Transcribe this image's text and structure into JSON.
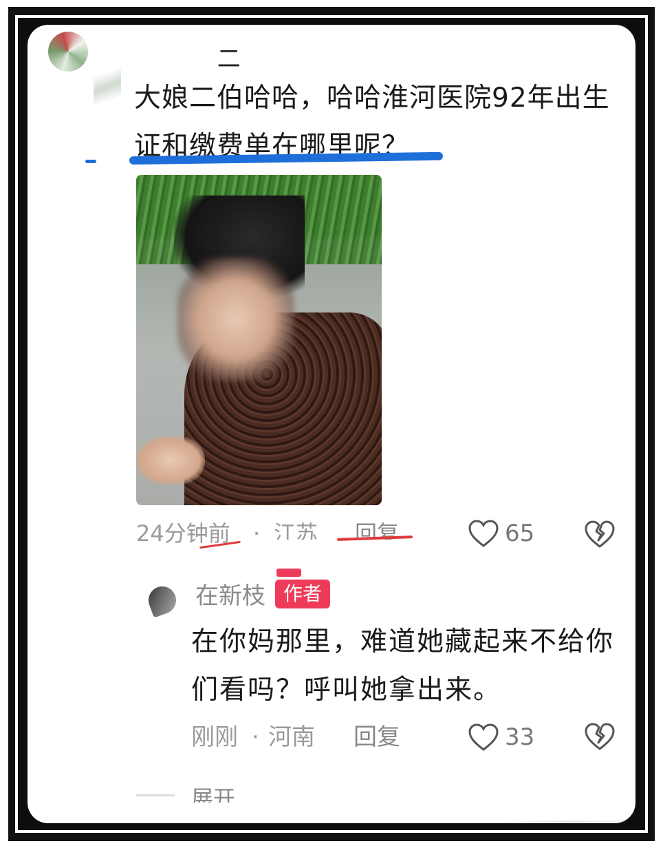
{
  "comment": {
    "username": "__ _二__",
    "text": "大娘二伯哈哈，哈哈淮河医院92年出生证和缴费单在哪里呢？",
    "image_icon": "photo-woman-blurred-face",
    "time": "24分钟前",
    "separator": "·",
    "location": "江苏",
    "reply_label": "回复",
    "like_count": "65",
    "like_icon": "heart-outline-icon",
    "dislike_icon": "broken-heart-icon"
  },
  "reply": {
    "username": "在新枝",
    "badge": "作者",
    "text": "在你妈那里，难道她藏起来不给你们看吗？呼叫她拿出来。",
    "time": "刚刚",
    "separator": "·",
    "location": "河南",
    "reply_label": "回复",
    "like_count": "33",
    "like_icon": "heart-outline-icon",
    "dislike_icon": "broken-heart-icon"
  },
  "expand": {
    "label": "展开"
  },
  "colors": {
    "underline": "#1e6fd9",
    "author_badge": "#ef3b5a",
    "annotation_red": "#e03a3a"
  }
}
